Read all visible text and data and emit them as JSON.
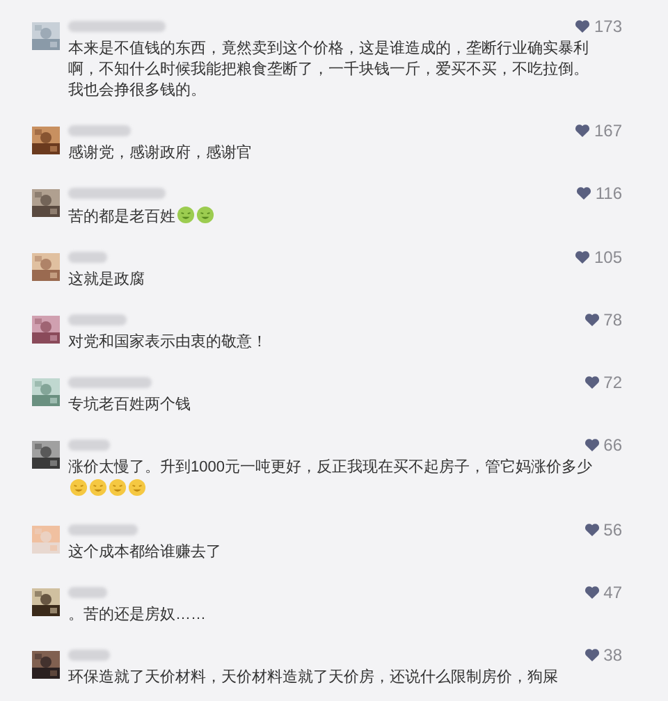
{
  "comments": [
    {
      "likes": "173",
      "text": "本来是不值钱的东西，竟然卖到这个价格，这是谁造成的，垄断行业确实暴利啊，不知什么时候我能把粮食垄断了，一千块钱一斤，爱买不买，不吃拉倒。我也会挣很多钱的。"
    },
    {
      "likes": "167",
      "text": "感谢党，感谢政府，感谢官"
    },
    {
      "likes": "116",
      "text": "苦的都是老百姓",
      "emojis": [
        {
          "kind": "green-face"
        },
        {
          "kind": "green-face"
        }
      ]
    },
    {
      "likes": "105",
      "text": "这就是政腐"
    },
    {
      "likes": "78",
      "text": "对党和国家表示由衷的敬意！"
    },
    {
      "likes": "72",
      "text": "专坑老百姓两个钱"
    },
    {
      "likes": "66",
      "text": "涨价太慢了。升到1000元一吨更好，反正我现在买不起房子，管它妈涨价多少",
      "emojis": [
        {
          "kind": "yellow-face"
        },
        {
          "kind": "yellow-face"
        },
        {
          "kind": "yellow-face"
        },
        {
          "kind": "yellow-face"
        }
      ]
    },
    {
      "likes": "56",
      "text": "这个成本都给谁赚去了"
    },
    {
      "likes": "47",
      "text": "。苦的还是房奴……"
    },
    {
      "likes": "38",
      "text": "环保造就了天价材料，天价材料造就了天价房，还说什么限制房价，狗屎"
    }
  ]
}
